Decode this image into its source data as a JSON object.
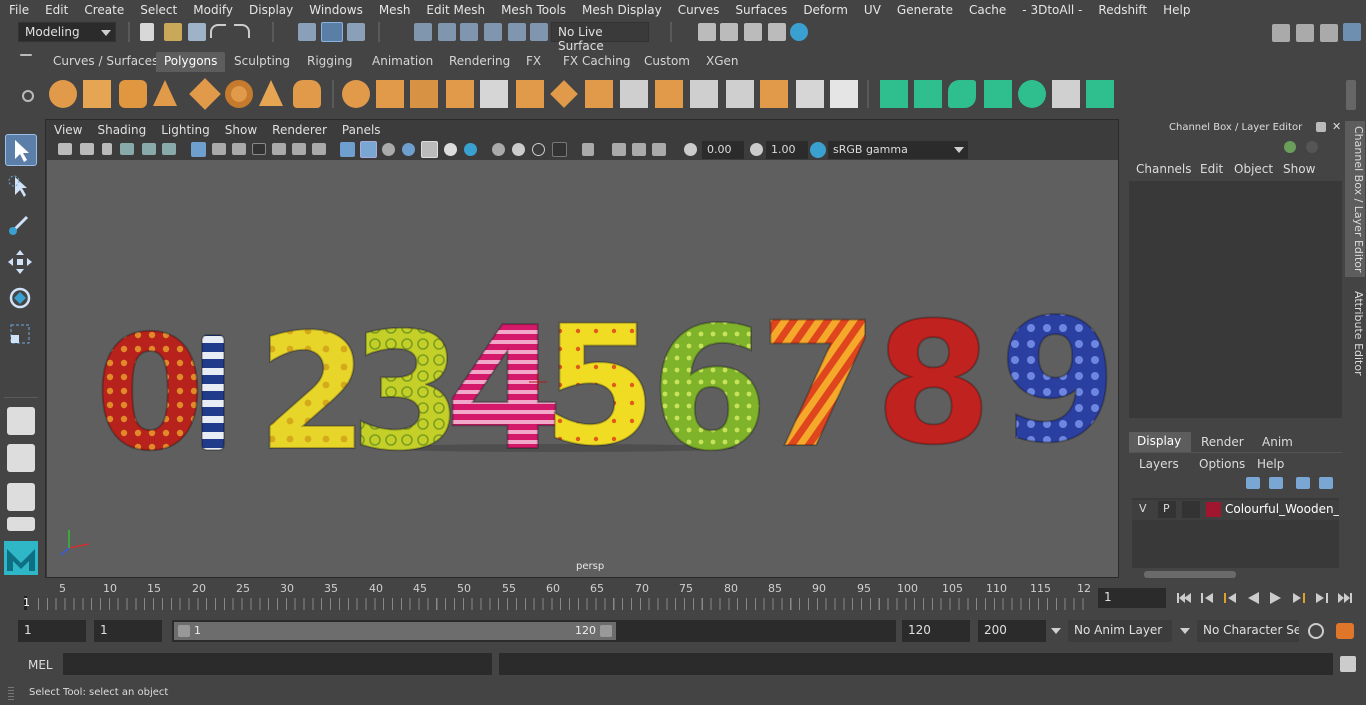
{
  "menus": [
    "File",
    "Edit",
    "Create",
    "Select",
    "Modify",
    "Display",
    "Windows",
    "Mesh",
    "Edit Mesh",
    "Mesh Tools",
    "Mesh Display",
    "Curves",
    "Surfaces",
    "Deform",
    "UV",
    "Generate",
    "Cache",
    "- 3DtoAll -",
    "Redshift",
    "Help"
  ],
  "status": {
    "workspace": "Modeling",
    "live_surface": "No Live Surface"
  },
  "shelf_tabs": [
    {
      "label": "Curves / Surfaces"
    },
    {
      "label": "Polygons",
      "active": true
    },
    {
      "label": "Sculpting"
    },
    {
      "label": "Rigging"
    },
    {
      "label": "Animation"
    },
    {
      "label": "Rendering"
    },
    {
      "label": "FX"
    },
    {
      "label": "FX Caching"
    },
    {
      "label": "Custom"
    },
    {
      "label": "XGen"
    }
  ],
  "viewport": {
    "menus": [
      "View",
      "Shading",
      "Lighting",
      "Show",
      "Renderer",
      "Panels"
    ],
    "exposure": "0.00",
    "gamma": "1.00",
    "color_space": "sRGB gamma",
    "camera_label": "persp",
    "digits": [
      "0",
      "1",
      "2",
      "3",
      "4",
      "5",
      "6",
      "7",
      "8",
      "9"
    ]
  },
  "channel_box": {
    "title": "Channel Box / Layer Editor",
    "menus": [
      "Channels",
      "Edit",
      "Object",
      "Show"
    ],
    "tabs": [
      "Display",
      "Render",
      "Anim"
    ],
    "layer_menus": [
      "Layers",
      "Options",
      "Help"
    ],
    "layer": {
      "v": "V",
      "p": "P",
      "name": "Colourful_Wooden_Nu",
      "color": "#a0162e"
    }
  },
  "side_tabs": [
    "Channel Box / Layer Editor",
    "Attribute Editor"
  ],
  "timeline": {
    "ticks": [
      "5",
      "10",
      "15",
      "20",
      "25",
      "30",
      "35",
      "40",
      "45",
      "50",
      "55",
      "60",
      "65",
      "70",
      "75",
      "80",
      "85",
      "90",
      "95",
      "100",
      "105",
      "110",
      "115",
      "12"
    ],
    "start_marker": "1",
    "current_frame": "1"
  },
  "range": {
    "start": "1",
    "playback_start": "1",
    "slider_start": "1",
    "slider_end": "120",
    "playback_end": "120",
    "end": "200",
    "anim_layer": "No Anim Layer",
    "character_set": "No Character Set"
  },
  "mel": {
    "label": "MEL"
  },
  "help_line": "Select Tool: select an object"
}
